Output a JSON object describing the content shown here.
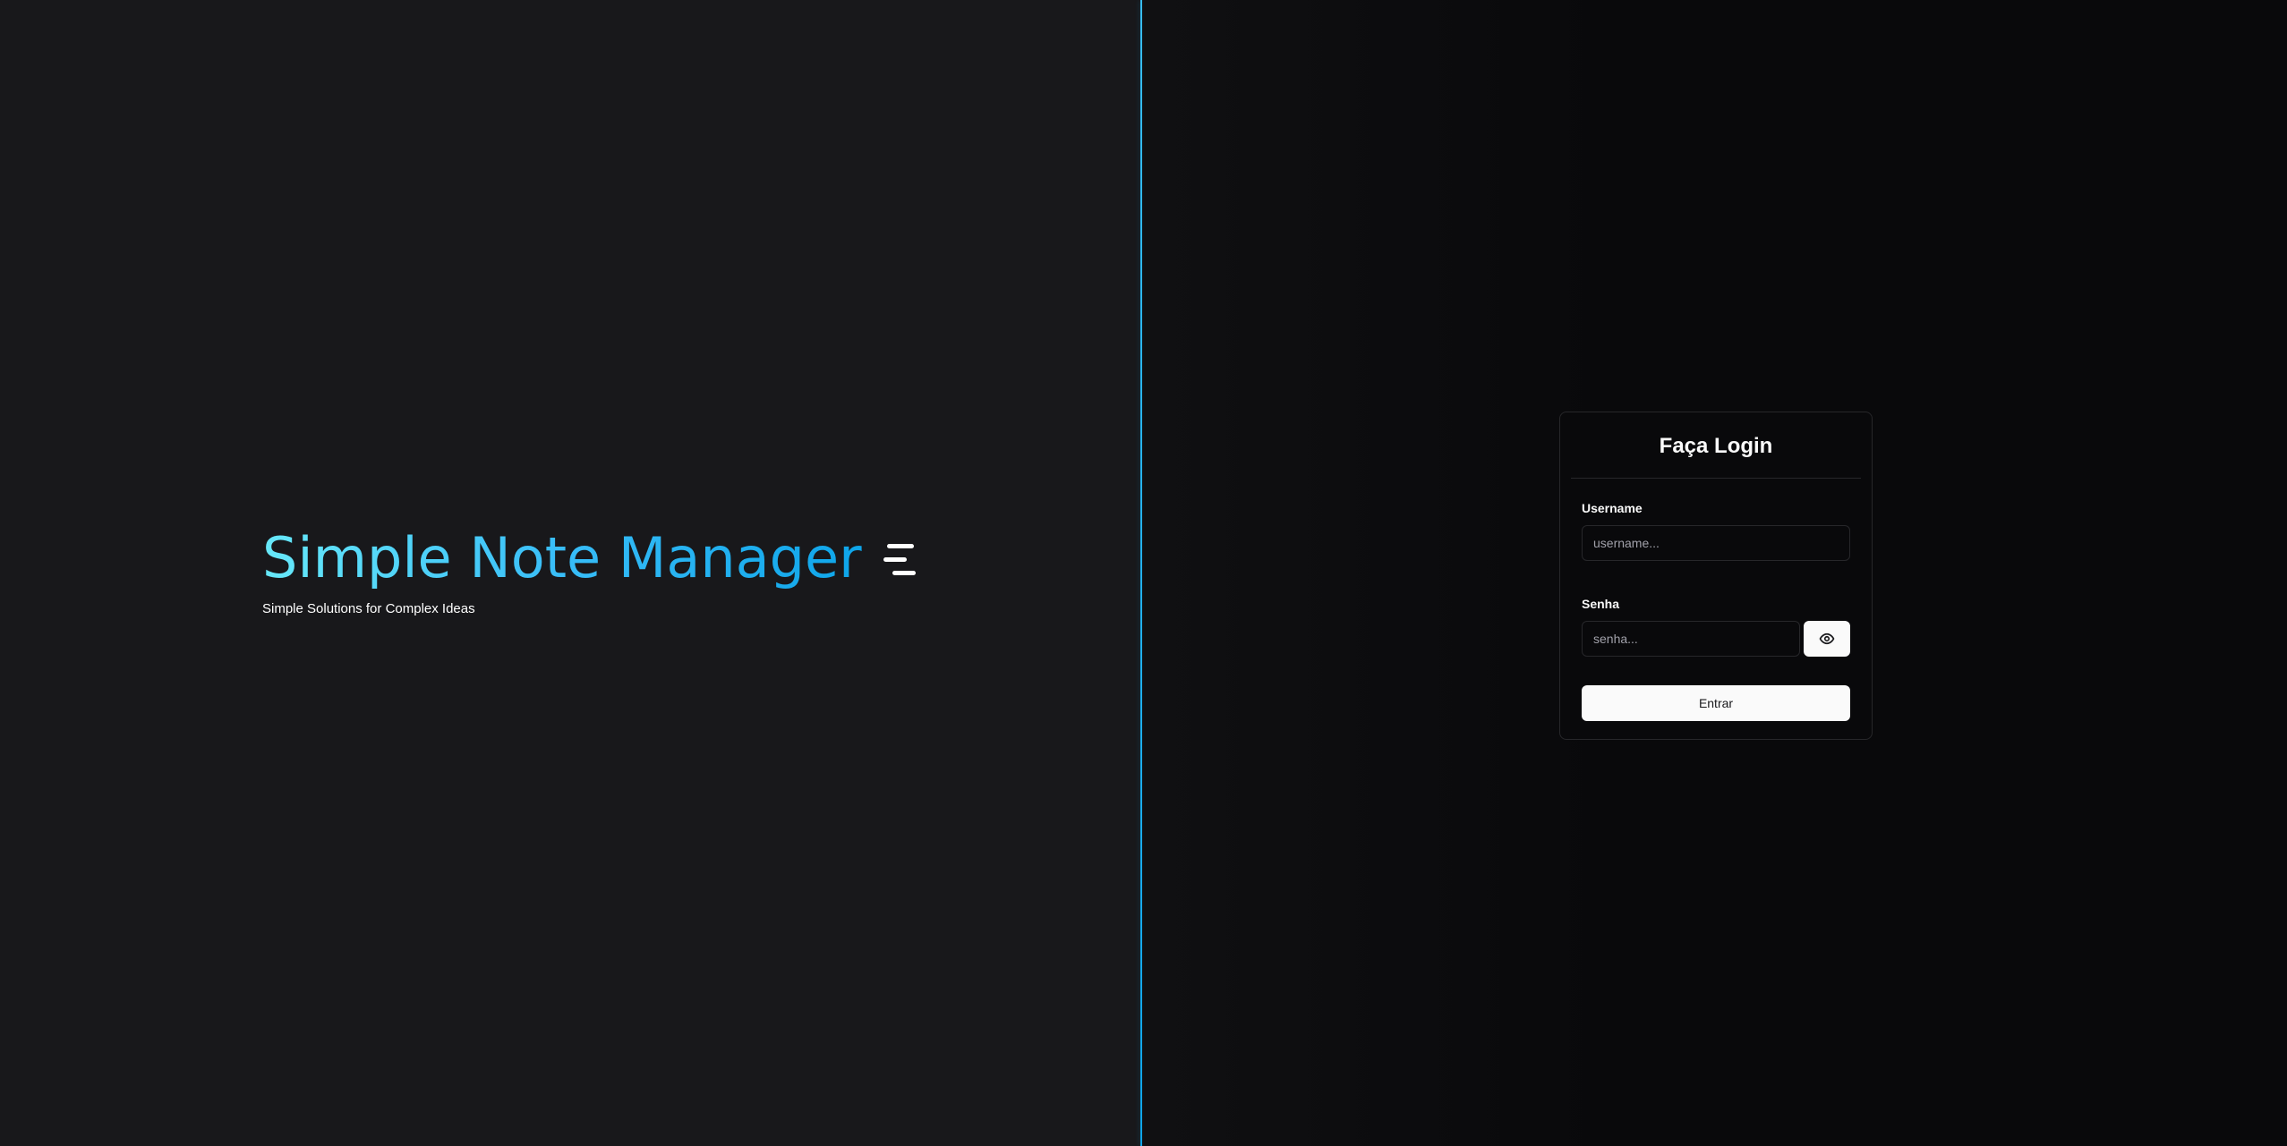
{
  "brand": {
    "title": "Simple Note Manager",
    "subtitle": "Simple Solutions for Complex Ideas",
    "icon": "menu-lines-icon"
  },
  "login": {
    "title": "Faça Login",
    "username_label": "Username",
    "username_placeholder": "username...",
    "username_value": "",
    "password_label": "Senha",
    "password_placeholder": "senha...",
    "password_value": "",
    "toggle_visibility_icon": "eye-icon",
    "submit_label": "Entrar"
  },
  "colors": {
    "left_background": "#18181b",
    "right_background": "#09090b",
    "accent_start": "#67e8f9",
    "accent_end": "#0ea5e9",
    "button_background": "#fafafa",
    "border": "#27272a"
  }
}
